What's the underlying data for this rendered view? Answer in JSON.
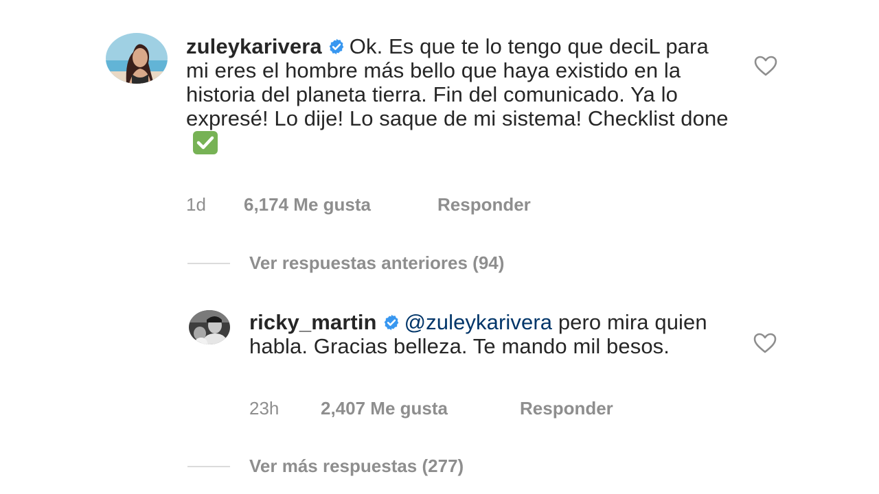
{
  "comment": {
    "username": "zuleykarivera",
    "text": "Ok. Es que te lo tengo que deciL para mi eres el hombre más bello que haya existido en la historia del planeta tierra. Fin del comunicado. Ya lo expresé! Lo dije! Lo saque de mi sistema! Checklist done",
    "emoji": "white-heavy-check-mark",
    "time": "1d",
    "likes": "6,174 Me gusta",
    "reply_label": "Responder",
    "avatar": "profile-photo",
    "like_icon": "heart-outline-icon",
    "verified_icon": "verified-badge-icon"
  },
  "previous_replies_label": "Ver respuestas anteriores (94)",
  "reply": {
    "username": "ricky_martin",
    "mention": "@zuleykarivera",
    "text": "pero mira quien habla. Gracias belleza. Te mando mil besos.",
    "time": "23h",
    "likes": "2,407 Me gusta",
    "reply_label": "Responder",
    "avatar": "profile-photo",
    "like_icon": "heart-outline-icon",
    "verified_icon": "verified-badge-icon"
  },
  "more_replies_label": "Ver más respuestas (277)",
  "colors": {
    "text": "#262626",
    "secondary": "#8e8e8e",
    "mention": "#003569",
    "verified": "#3897f0",
    "divider": "#dbdbdb",
    "check_emoji": "#77b255"
  }
}
